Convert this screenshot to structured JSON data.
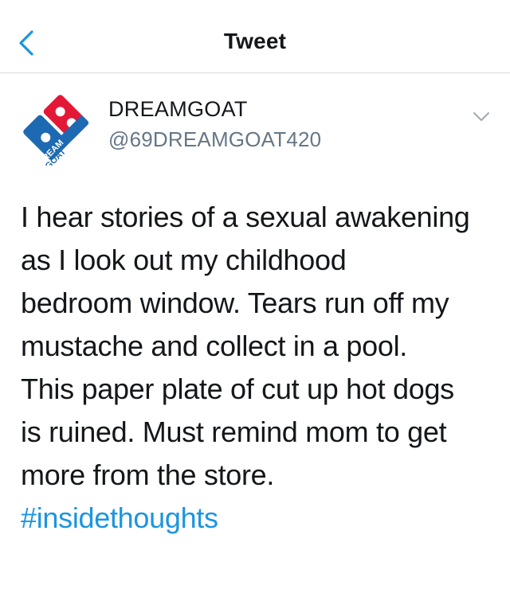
{
  "header": {
    "title": "Tweet",
    "back_icon": "chevron-left-icon"
  },
  "author": {
    "display_name": "DREAMGOAT",
    "handle": "@69DREAMGOAT420",
    "avatar_text_line1": "DREAM",
    "avatar_text_line2": "GOAT",
    "menu_icon": "chevron-down-icon"
  },
  "tweet": {
    "lines": [
      "I hear stories of a sexual awakening",
      "as I look out my childhood",
      "bedroom window. Tears run off my",
      "mustache and collect in a pool.",
      "This paper plate of cut up hot dogs",
      "is ruined. Must remind mom to get",
      "more from the store."
    ],
    "hashtag": "#insidethoughts"
  },
  "colors": {
    "accent": "#1b95e0",
    "text": "#14171a",
    "secondary_text": "#657786",
    "divider": "#d6dbe0",
    "logo_blue": "#1d6ab3",
    "logo_red": "#e31837"
  }
}
